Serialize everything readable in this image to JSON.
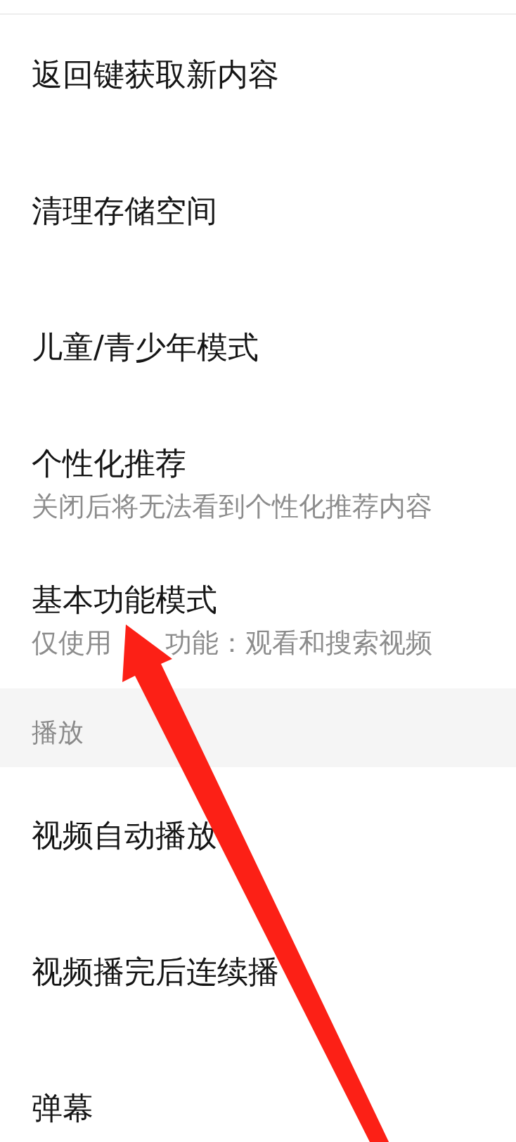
{
  "sections": [
    {
      "items": [
        {
          "title": "返回键获取新内容"
        },
        {
          "title": "清理存储空间"
        },
        {
          "title": "儿童/青少年模式"
        },
        {
          "title": "个性化推荐",
          "description": [
            "关闭后将无法看到个性化推荐内容"
          ]
        },
        {
          "title": "基本功能模式",
          "description": [
            "仅使用",
            "功能：观看和搜索视频"
          ]
        }
      ]
    },
    {
      "header": "播放",
      "items": [
        {
          "title": "视频自动播放"
        },
        {
          "title": "视频播完后连续播"
        },
        {
          "title": "弹幕"
        }
      ]
    }
  ],
  "annotation": {
    "kind": "arrow"
  }
}
